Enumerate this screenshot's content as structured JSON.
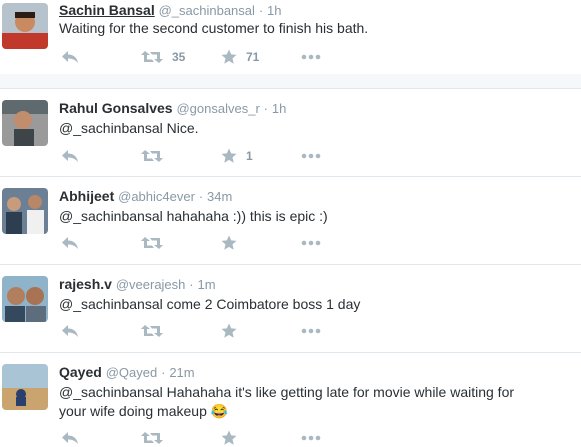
{
  "tweets": [
    {
      "name": "Sachin Bansal",
      "handle": "@_sachinbansal",
      "time": "1h",
      "text": "Waiting for the second customer to finish his bath.",
      "retweets": "35",
      "favorites": "71"
    },
    {
      "name": "Rahul Gonsalves",
      "handle": "@gonsalves_r",
      "time": "1h",
      "text": "@_sachinbansal Nice.",
      "retweets": "",
      "favorites": "1"
    },
    {
      "name": "Abhijeet",
      "handle": "@abhic4ever",
      "time": "34m",
      "text": "@_sachinbansal hahahaha :)) this is epic :)",
      "retweets": "",
      "favorites": ""
    },
    {
      "name": "rajesh.v",
      "handle": "@veerajesh",
      "time": "1m",
      "text": "@_sachinbansal come 2 Coimbatore boss 1 day",
      "retweets": "",
      "favorites": ""
    },
    {
      "name": "Qayed",
      "handle": "@Qayed",
      "time": "21m",
      "text": "@_sachinbansal Hahahaha it's like getting late for movie while waiting for your wife doing makeup 😂",
      "retweets": "",
      "favorites": ""
    }
  ],
  "separator": "·",
  "icons": {
    "reply": "reply-icon",
    "retweet": "retweet-icon",
    "favorite": "star-icon",
    "more": "more-icon"
  },
  "colors": {
    "action_gray": "#aab8c2",
    "meta_gray": "#8899a6",
    "text": "#292f33",
    "divider": "#e1e8ed"
  }
}
